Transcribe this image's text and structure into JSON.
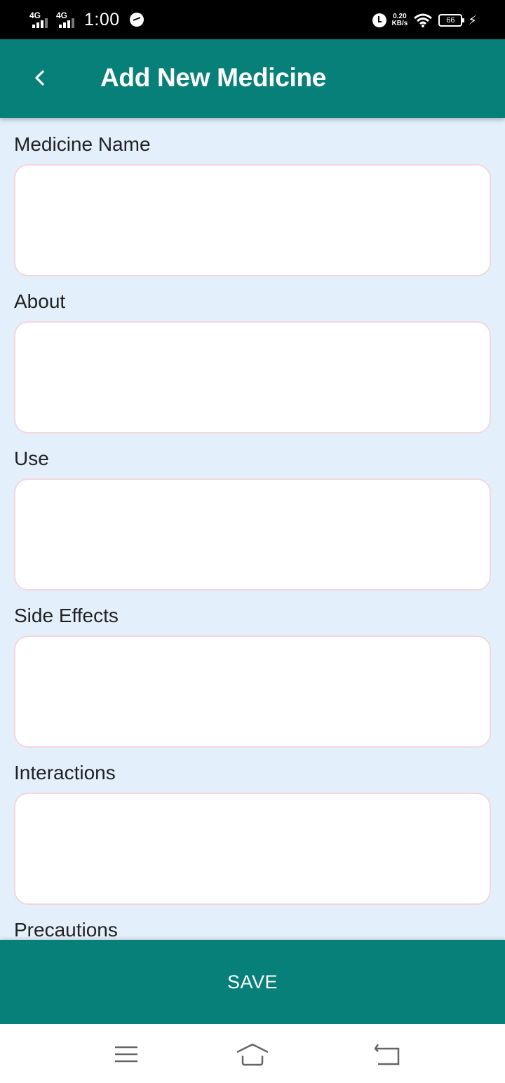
{
  "status_bar": {
    "network_1": "4G",
    "network_2": "4G",
    "time": "1:00",
    "speed_value": "0.20",
    "speed_unit": "KB/s",
    "battery": "66"
  },
  "app_bar": {
    "title": "Add New Medicine"
  },
  "form": {
    "fields": [
      {
        "label": "Medicine Name",
        "value": ""
      },
      {
        "label": "About",
        "value": ""
      },
      {
        "label": "Use",
        "value": ""
      },
      {
        "label": "Side Effects",
        "value": ""
      },
      {
        "label": "Interactions",
        "value": ""
      },
      {
        "label": "Precautions",
        "value": ""
      }
    ]
  },
  "save_button": {
    "label": "SAVE"
  },
  "colors": {
    "primary": "#08807a",
    "background": "#e3f0fc",
    "input_border": "#f4d6dc"
  },
  "icons": {
    "back": "chevron-left-icon",
    "nav_menu": "menu-icon",
    "nav_home": "home-icon",
    "nav_back": "back-icon"
  }
}
